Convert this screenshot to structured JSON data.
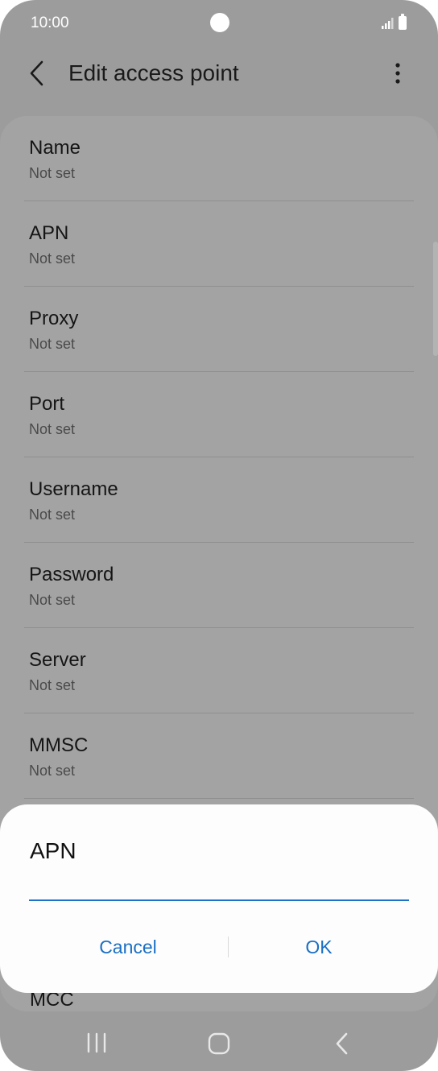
{
  "status_bar": {
    "time": "10:00"
  },
  "app_bar": {
    "title": "Edit access point"
  },
  "settings": {
    "items": [
      {
        "title": "Name",
        "value": "Not set"
      },
      {
        "title": "APN",
        "value": "Not set"
      },
      {
        "title": "Proxy",
        "value": "Not set"
      },
      {
        "title": "Port",
        "value": "Not set"
      },
      {
        "title": "Username",
        "value": "Not set"
      },
      {
        "title": "Password",
        "value": "Not set"
      },
      {
        "title": "Server",
        "value": "Not set"
      },
      {
        "title": "MMSC",
        "value": "Not set"
      }
    ],
    "partial_item_title": "MCC"
  },
  "dialog": {
    "title": "APN",
    "input_value": "",
    "cancel_label": "Cancel",
    "ok_label": "OK",
    "accent_color": "#1a6fc4"
  },
  "icons": {
    "back": "back-arrow-icon",
    "more": "more-vertical-icon",
    "nav_recent": "recent-apps-icon",
    "nav_home": "home-icon",
    "nav_back": "nav-back-icon"
  }
}
